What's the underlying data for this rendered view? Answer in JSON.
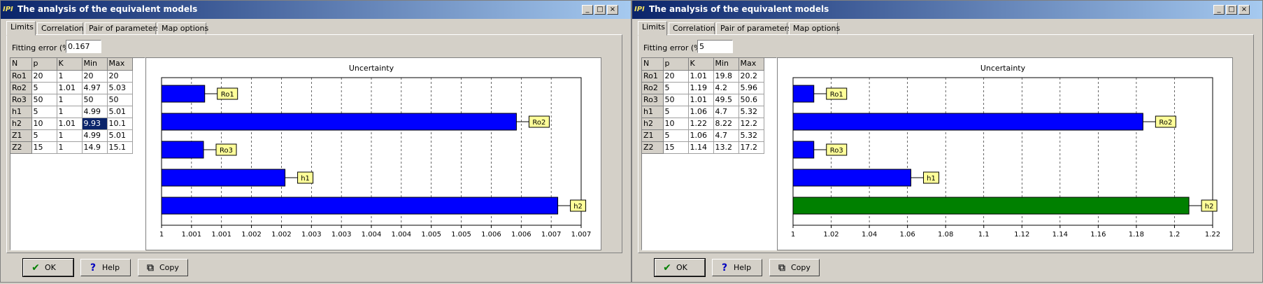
{
  "windows": [
    {
      "title": "The analysis of the equivalent models",
      "app_icon_text": "IPI",
      "tabs": [
        "Limits",
        "Correlation",
        "Pair of parameters",
        "Map options"
      ],
      "fitting_label": "Fitting error (%)",
      "fitting_value": "0.167",
      "table": {
        "headers": [
          "N",
          "p",
          "K",
          "Min",
          "Max"
        ],
        "rows": [
          [
            "Ro1",
            "20",
            "1",
            "20",
            "20"
          ],
          [
            "Ro2",
            "5",
            "1.01",
            "4.97",
            "5.03"
          ],
          [
            "Ro3",
            "50",
            "1",
            "50",
            "50"
          ],
          [
            "h1",
            "5",
            "1",
            "4.99",
            "5.01"
          ],
          [
            "h2",
            "10",
            "1.01",
            "9.93",
            "10.1"
          ],
          [
            "Z1",
            "5",
            "1",
            "4.99",
            "5.01"
          ],
          [
            "Z2",
            "15",
            "1",
            "14.9",
            "15.1"
          ]
        ],
        "selected_cell": "4-3"
      },
      "buttons": {
        "ok": "OK",
        "help": "Help",
        "copy": "Copy"
      },
      "chart_data": {
        "type": "bar",
        "orientation": "horizontal",
        "title": "Uncertainty",
        "categories": [
          "Ro1",
          "Ro2",
          "Ro3",
          "h1",
          "h2"
        ],
        "values": [
          1.00072,
          1.00592,
          1.0007,
          1.00206,
          1.00661
        ],
        "bar_colors": [
          "#0000ff",
          "#0000ff",
          "#0000ff",
          "#0000ff",
          "#0000ff"
        ],
        "xlim": [
          1,
          1.007
        ],
        "xticks": [
          "1",
          "1.001",
          "1.001",
          "1.002",
          "1.002",
          "1.003",
          "1.003",
          "1.004",
          "1.004",
          "1.005",
          "1.005",
          "1.006",
          "1.006",
          "1.007",
          "1.007"
        ],
        "grid": true,
        "label_color": "#ffff99"
      }
    },
    {
      "title": "The analysis of the equivalent models",
      "app_icon_text": "IPI",
      "tabs": [
        "Limits",
        "Correlation",
        "Pair of parameters",
        "Map options"
      ],
      "fitting_label": "Fitting error (%)",
      "fitting_value": "5",
      "table": {
        "headers": [
          "N",
          "p",
          "K",
          "Min",
          "Max"
        ],
        "rows": [
          [
            "Ro1",
            "20",
            "1.01",
            "19.8",
            "20.2"
          ],
          [
            "Ro2",
            "5",
            "1.19",
            "4.2",
            "5.96"
          ],
          [
            "Ro3",
            "50",
            "1.01",
            "49.5",
            "50.6"
          ],
          [
            "h1",
            "5",
            "1.06",
            "4.7",
            "5.32"
          ],
          [
            "h2",
            "10",
            "1.22",
            "8.22",
            "12.2"
          ],
          [
            "Z1",
            "5",
            "1.06",
            "4.7",
            "5.32"
          ],
          [
            "Z2",
            "15",
            "1.14",
            "13.2",
            "17.2"
          ]
        ],
        "selected_cell": ""
      },
      "buttons": {
        "ok": "OK",
        "help": "Help",
        "copy": "Copy"
      },
      "chart_data": {
        "type": "bar",
        "orientation": "horizontal",
        "title": "Uncertainty",
        "categories": [
          "Ro1",
          "Ro2",
          "Ro3",
          "h1",
          "h2"
        ],
        "values": [
          1.0114,
          1.1918,
          1.0114,
          1.0646,
          1.217
        ],
        "bar_colors": [
          "#0000ff",
          "#0000ff",
          "#0000ff",
          "#0000ff",
          "#008000"
        ],
        "xlim": [
          1,
          1.23
        ],
        "xticks": [
          "1",
          "1.02",
          "1.04",
          "1.06",
          "1.08",
          "1.1",
          "1.12",
          "1.14",
          "1.16",
          "1.18",
          "1.2",
          "1.22"
        ],
        "grid": true,
        "label_color": "#ffff99"
      }
    }
  ]
}
